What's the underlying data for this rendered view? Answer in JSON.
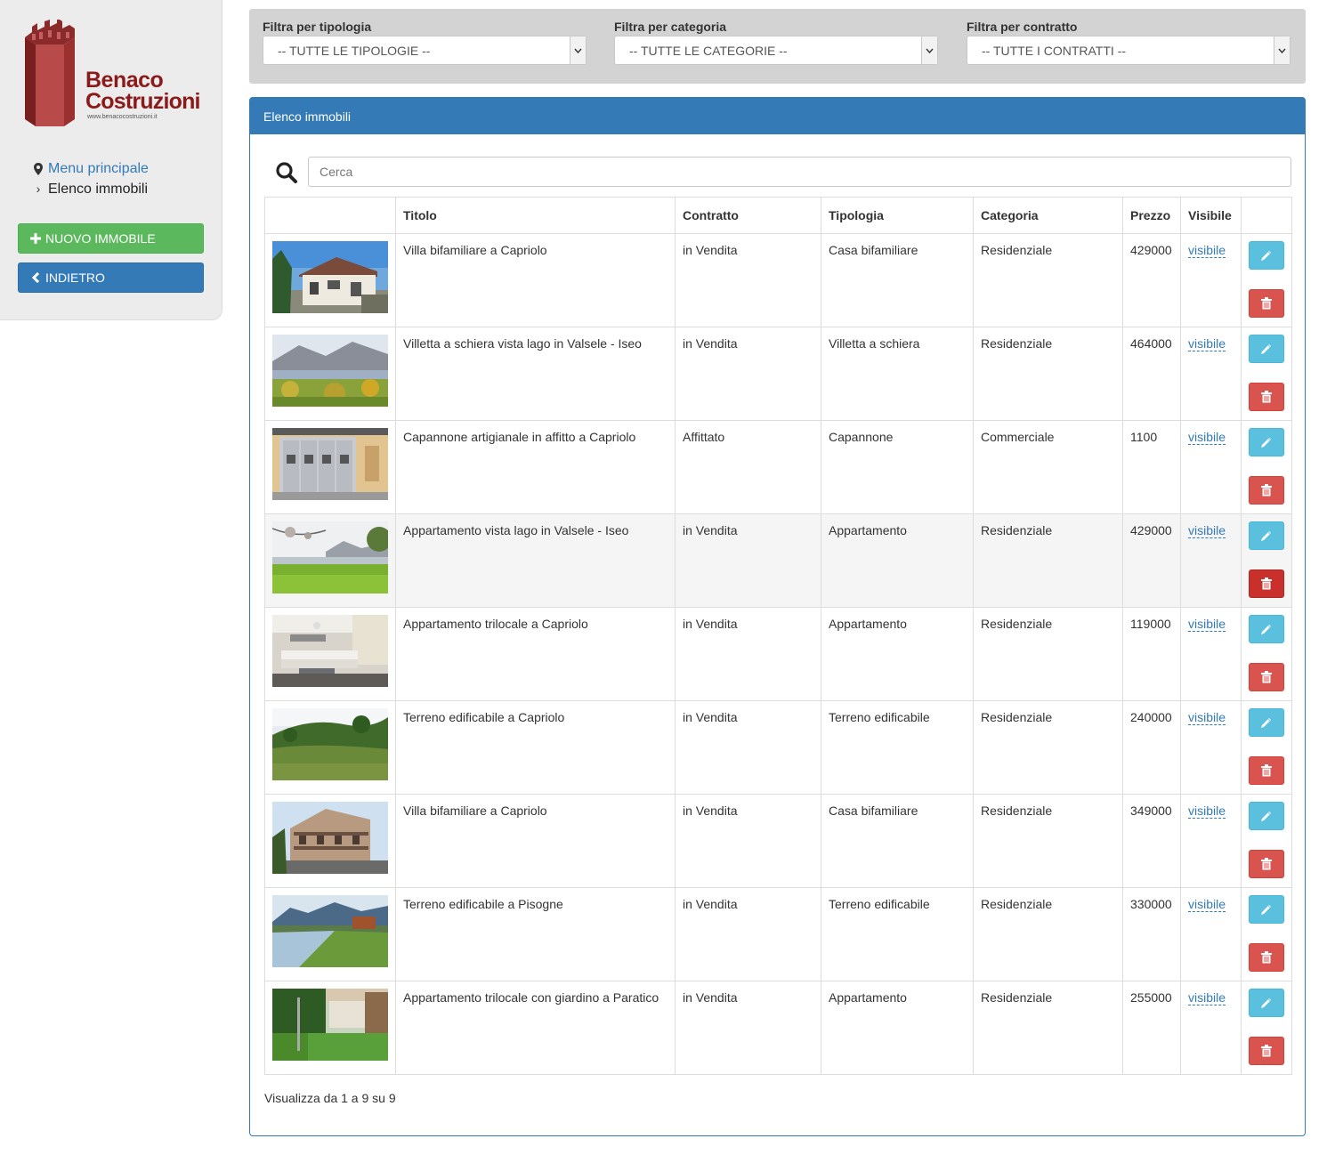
{
  "brand": {
    "line1": "Benaco",
    "line2": "Costruzioni",
    "url": "www.benacocostruzioni.it",
    "tower_text": "Benaco Costruzioni",
    "color": "#8b1a1a"
  },
  "breadcrumb": {
    "home": "Menu principale",
    "current": "Elenco immobili"
  },
  "sidebar": {
    "new_label": "NUOVO IMMOBILE",
    "back_label": "INDIETRO"
  },
  "filters": [
    {
      "label": "Filtra per tipologia",
      "value": "-- TUTTE LE TIPOLOGIE --"
    },
    {
      "label": "Filtra per categoria",
      "value": "-- TUTTE LE CATEGORIE --"
    },
    {
      "label": "Filtra per contratto",
      "value": "-- TUTTE I CONTRATTI --"
    }
  ],
  "panel": {
    "title": "Elenco immobili",
    "search_placeholder": "Cerca"
  },
  "table": {
    "headers": [
      "",
      "Titolo",
      "Contratto",
      "Tipologia",
      "Categoria",
      "Prezzo",
      "Visibile",
      ""
    ],
    "rows": [
      {
        "title": "Villa bifamiliare a Capriolo",
        "contract": "in Vendita",
        "type": "Casa bifamiliare",
        "category": "Residenziale",
        "price": "429000",
        "visible": "visibile",
        "photo": "house"
      },
      {
        "title": "Villetta a schiera vista lago in Valsele - Iseo",
        "contract": "in Vendita",
        "type": "Villetta a schiera",
        "category": "Residenziale",
        "price": "464000",
        "visible": "visibile",
        "photo": "lake"
      },
      {
        "title": "Capannone artigianale in affitto a Capriolo",
        "contract": "Affittato",
        "type": "Capannone",
        "category": "Commerciale",
        "price": "1100",
        "visible": "visibile",
        "photo": "garage"
      },
      {
        "title": "Appartamento vista lago in Valsele - Iseo",
        "contract": "in Vendita",
        "type": "Appartamento",
        "category": "Residenziale",
        "price": "429000",
        "visible": "visibile",
        "photo": "meadow"
      },
      {
        "title": "Appartamento trilocale a Capriolo",
        "contract": "in Vendita",
        "type": "Appartamento",
        "category": "Residenziale",
        "price": "119000",
        "visible": "visibile",
        "photo": "living"
      },
      {
        "title": "Terreno edificabile a Capriolo",
        "contract": "in Vendita",
        "type": "Terreno edificabile",
        "category": "Residenziale",
        "price": "240000",
        "visible": "visibile",
        "photo": "field"
      },
      {
        "title": "Villa bifamiliare a Capriolo",
        "contract": "in Vendita",
        "type": "Casa bifamiliare",
        "category": "Residenziale",
        "price": "349000",
        "visible": "visibile",
        "photo": "building"
      },
      {
        "title": "Terreno edificabile a Pisogne",
        "contract": "in Vendita",
        "type": "Terreno edificabile",
        "category": "Residenziale",
        "price": "330000",
        "visible": "visibile",
        "photo": "river"
      },
      {
        "title": "Appartamento trilocale con giardino a Paratico",
        "contract": "in Vendita",
        "type": "Appartamento",
        "category": "Residenziale",
        "price": "255000",
        "visible": "visibile",
        "photo": "garden"
      }
    ]
  },
  "footer": {
    "info": "Visualizza da 1 a 9 su 9"
  },
  "colors": {
    "primary": "#337ab7",
    "success": "#5cb85c",
    "info": "#5bc0de",
    "danger": "#d9534f"
  },
  "icons": {
    "search": "search-icon",
    "pin": "map-marker-icon",
    "plus": "plus-icon",
    "back": "chevron-left-icon",
    "edit": "pencil-icon",
    "delete": "trash-icon"
  }
}
